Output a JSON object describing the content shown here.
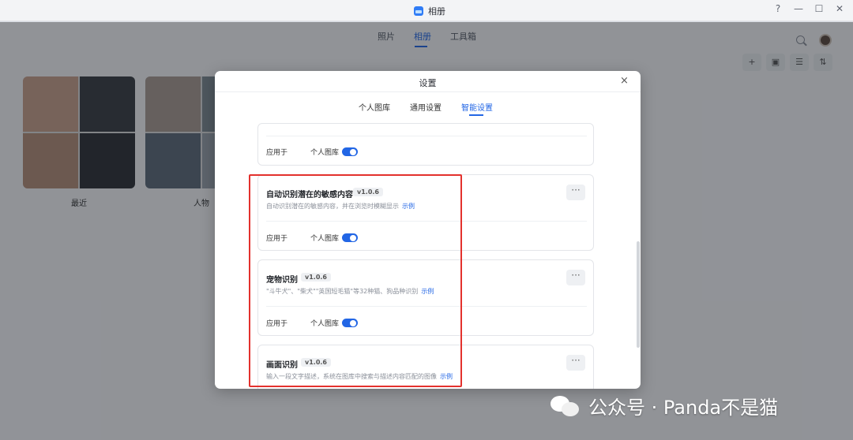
{
  "window": {
    "title": "相册",
    "controls": [
      "?",
      "—",
      "☐",
      "✕"
    ]
  },
  "app_nav": {
    "tabs": [
      "照片",
      "相册",
      "工具箱"
    ],
    "active": "相册"
  },
  "albums": [
    {
      "label": "最近"
    },
    {
      "label": "人物"
    }
  ],
  "modal": {
    "title": "设置",
    "close": "×",
    "tabs": [
      "个人图库",
      "通用设置",
      "智能设置"
    ],
    "active_tab": "智能设置"
  },
  "cards": [
    {
      "apply_label": "应用于",
      "library": "个人图库",
      "enabled": true
    },
    {
      "name": "自动识别潜在的敏感内容",
      "version": "v1.0.6",
      "description": "自动识别潜在的敏感内容，并在浏览时模糊显示",
      "link": "示例",
      "more": "···",
      "apply_label": "应用于",
      "library": "个人图库",
      "enabled": true
    },
    {
      "name": "宠物识别",
      "version": "v1.0.6",
      "description": "\"斗牛犬\"、\"柴犬\"\"英国短毛猫\"等32种猫、狗品种识别",
      "link": "示例",
      "more": "···",
      "apply_label": "应用于",
      "library": "个人图库",
      "enabled": true
    },
    {
      "name": "画面识别",
      "version": "v1.0.6",
      "description": "输入一段文字描述，系统在图库中搜索与描述内容匹配的图像",
      "link": "示例",
      "more": "···"
    }
  ],
  "watermark": "公众号 · Panda不是猫",
  "colors": {
    "accent": "#2266e5",
    "highlight": "#e3312d"
  }
}
